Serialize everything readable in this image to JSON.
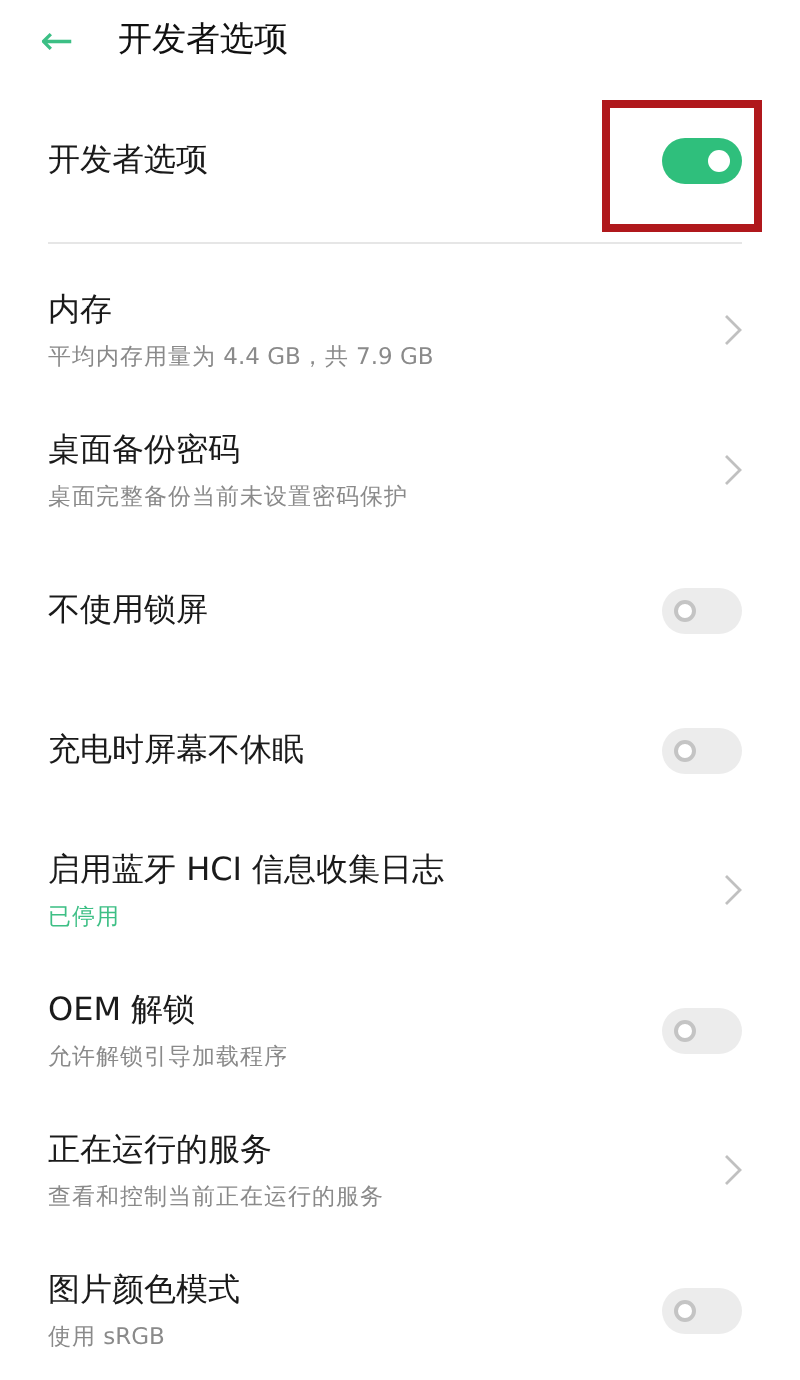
{
  "header": {
    "back": "←",
    "title": "开发者选项"
  },
  "master": {
    "label": "开发者选项",
    "on": true,
    "highlighted": true
  },
  "items": [
    {
      "kind": "chevron",
      "title": "内存",
      "subtitle": "平均内存用量为 4.4 GB，共 7.9 GB",
      "subtitle_accent": false
    },
    {
      "kind": "chevron",
      "title": "桌面备份密码",
      "subtitle": "桌面完整备份当前未设置密码保护",
      "subtitle_accent": false
    },
    {
      "kind": "switch",
      "title": "不使用锁屏",
      "on": false
    },
    {
      "kind": "switch",
      "title": "充电时屏幕不休眠",
      "on": false
    },
    {
      "kind": "chevron",
      "title": "启用蓝牙 HCI 信息收集日志",
      "subtitle": "已停用",
      "subtitle_accent": true
    },
    {
      "kind": "switch",
      "title": "OEM 解锁",
      "subtitle": "允许解锁引导加载程序",
      "subtitle_accent": false,
      "on": false
    },
    {
      "kind": "chevron",
      "title": "正在运行的服务",
      "subtitle": "查看和控制当前正在运行的服务",
      "subtitle_accent": false
    },
    {
      "kind": "switch",
      "title": "图片颜色模式",
      "subtitle": "使用 sRGB",
      "subtitle_accent": false,
      "on": false
    }
  ]
}
